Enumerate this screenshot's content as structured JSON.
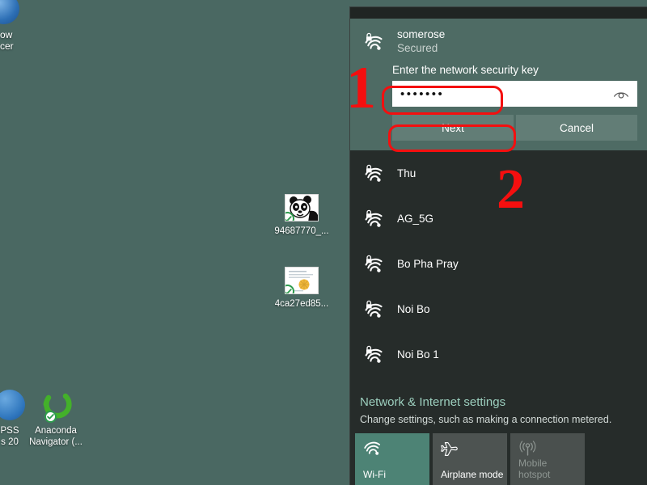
{
  "desktop": {
    "background_color": "#4a6862",
    "cut_off_icon": {
      "name": "blue-globe-icon",
      "label_line1": "ow",
      "label_line2": "cer"
    },
    "icons": [
      {
        "name": "image-file-panda",
        "label": "94687770_...",
        "synced": true
      },
      {
        "name": "image-file-doc",
        "label": "4ca27ed85...",
        "synced": true
      }
    ],
    "taskbar_icons": [
      {
        "name": "spss-icon",
        "label_line1": "PSS",
        "label_line2": "s 20"
      },
      {
        "name": "anaconda-navigator-icon",
        "label_line1": "Anaconda",
        "label_line2": "Navigator (..."
      }
    ]
  },
  "wifi_panel": {
    "accent_color": "#4d8375",
    "panel_background": "#262c2a",
    "selected_background": "#4e6b64",
    "selected_network": {
      "ssid": "somerose",
      "status": "Secured",
      "icon": "wifi-lock-icon",
      "key_label": "Enter the network security key",
      "password_value": "•••••••",
      "password_placeholder": "",
      "reveal_icon": "eye-icon",
      "next_label": "Next",
      "cancel_label": "Cancel"
    },
    "networks": [
      {
        "ssid": "Thu",
        "icon": "wifi-lock-icon",
        "secured": true
      },
      {
        "ssid": "AG_5G",
        "icon": "wifi-lock-icon",
        "secured": true
      },
      {
        "ssid": "Bo Pha Pray",
        "icon": "wifi-lock-icon",
        "secured": true
      },
      {
        "ssid": "Noi Bo",
        "icon": "wifi-lock-icon",
        "secured": true
      },
      {
        "ssid": "Noi Bo 1",
        "icon": "wifi-lock-icon",
        "secured": true
      }
    ],
    "settings": {
      "title": "Network & Internet settings",
      "subtitle": "Change settings, such as making a connection metered.",
      "title_color": "#9ccfbe"
    },
    "tiles": [
      {
        "label": "Wi-Fi",
        "icon": "wifi-icon",
        "state": "active"
      },
      {
        "label": "Airplane mode",
        "icon": "airplane-icon",
        "state": "inactive"
      },
      {
        "label": "Mobile\nhotspot",
        "icon": "mobile-hotspot-icon",
        "state": "disabled"
      }
    ]
  },
  "annotations": [
    {
      "label": "1",
      "color": "#f40f0f"
    },
    {
      "label": "2",
      "color": "#f40f0f"
    }
  ]
}
